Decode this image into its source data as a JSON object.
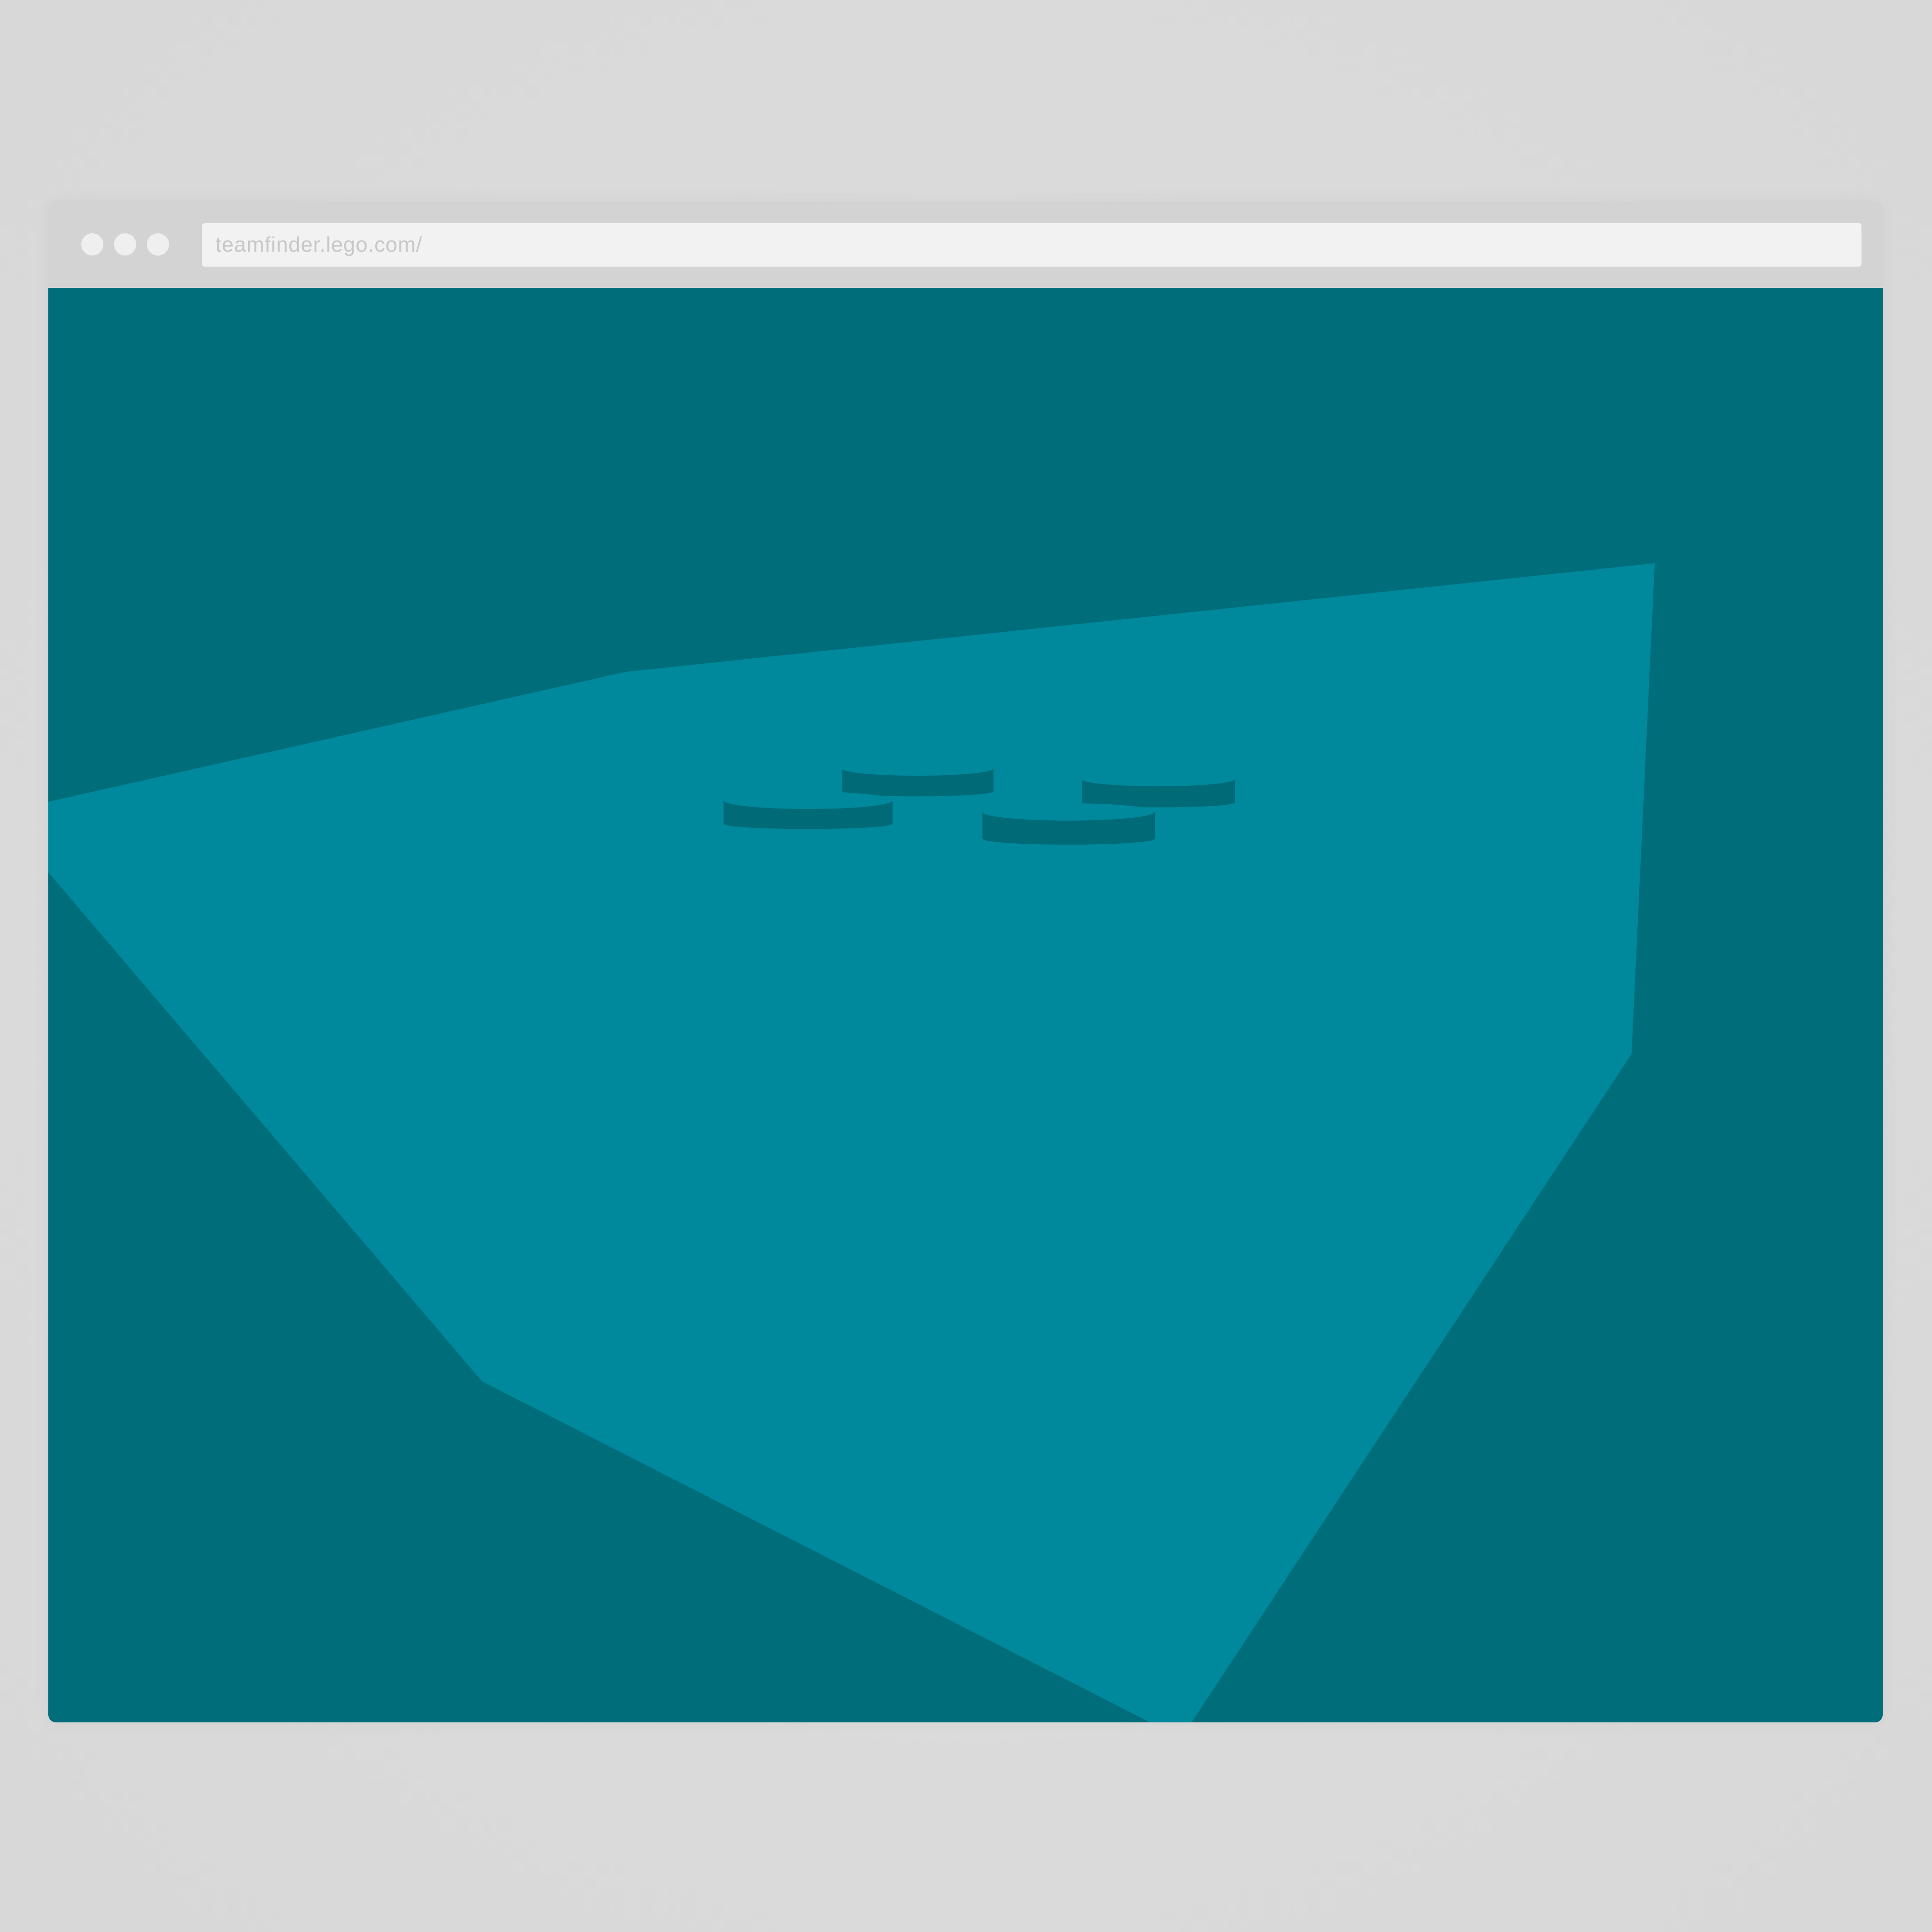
{
  "browser": {
    "address_bar": {
      "url": "teamfinder.lego.com/"
    },
    "traffic_dots": [
      {
        "name": "window-dot-1"
      },
      {
        "name": "window-dot-2"
      },
      {
        "name": "window-dot-3"
      }
    ]
  },
  "colors": {
    "page_background": "#d9d9d9",
    "titlebar": "#d3d3d3",
    "address_bar_bg": "#f2f2f2",
    "address_bar_text": "#c7c7c7",
    "traffic_dot": "#efefef",
    "scene_background": "#006d7a",
    "lit_floor": "#00889c",
    "brick_shadow": "#006a77"
  }
}
